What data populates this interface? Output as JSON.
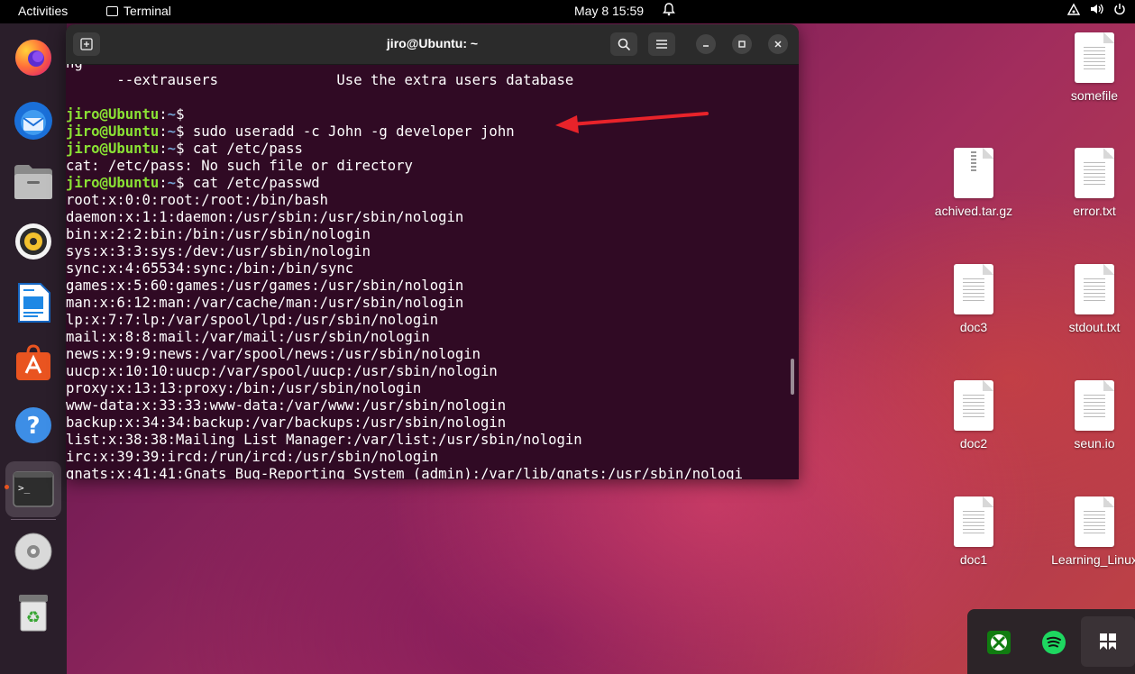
{
  "topbar": {
    "activities": "Activities",
    "app_name": "Terminal",
    "datetime": "May 8  15:59"
  },
  "dock": {
    "items": [
      "firefox",
      "thunderbird",
      "files",
      "rhythmbox",
      "libreoffice-writer",
      "app-center",
      "help",
      "terminal",
      "dvd",
      "trash"
    ]
  },
  "terminal": {
    "title": "jiro@Ubuntu: ~",
    "lines": [
      {
        "type": "text",
        "text": "ng"
      },
      {
        "type": "text",
        "text": "      --extrausers              Use the extra users database"
      },
      {
        "type": "text",
        "text": ""
      },
      {
        "type": "prompt",
        "user": "jiro@Ubuntu",
        "path": "~",
        "cmd": ""
      },
      {
        "type": "prompt",
        "user": "jiro@Ubuntu",
        "path": "~",
        "cmd": " sudo useradd -c John -g developer john"
      },
      {
        "type": "prompt",
        "user": "jiro@Ubuntu",
        "path": "~",
        "cmd": " cat /etc/pass"
      },
      {
        "type": "text",
        "text": "cat: /etc/pass: No such file or directory"
      },
      {
        "type": "prompt",
        "user": "jiro@Ubuntu",
        "path": "~",
        "cmd": " cat /etc/passwd"
      },
      {
        "type": "text",
        "text": "root:x:0:0:root:/root:/bin/bash"
      },
      {
        "type": "text",
        "text": "daemon:x:1:1:daemon:/usr/sbin:/usr/sbin/nologin"
      },
      {
        "type": "text",
        "text": "bin:x:2:2:bin:/bin:/usr/sbin/nologin"
      },
      {
        "type": "text",
        "text": "sys:x:3:3:sys:/dev:/usr/sbin/nologin"
      },
      {
        "type": "text",
        "text": "sync:x:4:65534:sync:/bin:/bin/sync"
      },
      {
        "type": "text",
        "text": "games:x:5:60:games:/usr/games:/usr/sbin/nologin"
      },
      {
        "type": "text",
        "text": "man:x:6:12:man:/var/cache/man:/usr/sbin/nologin"
      },
      {
        "type": "text",
        "text": "lp:x:7:7:lp:/var/spool/lpd:/usr/sbin/nologin"
      },
      {
        "type": "text",
        "text": "mail:x:8:8:mail:/var/mail:/usr/sbin/nologin"
      },
      {
        "type": "text",
        "text": "news:x:9:9:news:/var/spool/news:/usr/sbin/nologin"
      },
      {
        "type": "text",
        "text": "uucp:x:10:10:uucp:/var/spool/uucp:/usr/sbin/nologin"
      },
      {
        "type": "text",
        "text": "proxy:x:13:13:proxy:/bin:/usr/sbin/nologin"
      },
      {
        "type": "text",
        "text": "www-data:x:33:33:www-data:/var/www:/usr/sbin/nologin"
      },
      {
        "type": "text",
        "text": "backup:x:34:34:backup:/var/backups:/usr/sbin/nologin"
      },
      {
        "type": "text",
        "text": "list:x:38:38:Mailing List Manager:/var/list:/usr/sbin/nologin"
      },
      {
        "type": "text",
        "text": "irc:x:39:39:ircd:/run/ircd:/usr/sbin/nologin"
      },
      {
        "type": "text",
        "text": "gnats:x:41:41:Gnats Bug-Reporting System (admin):/var/lib/gnats:/usr/sbin/nologi"
      }
    ]
  },
  "desktop": {
    "icons": [
      {
        "label": "somefile",
        "kind": "text"
      },
      {
        "label": "achived.tar.gz",
        "kind": "archive"
      },
      {
        "label": "error.txt",
        "kind": "text"
      },
      {
        "label": "doc3",
        "kind": "text"
      },
      {
        "label": "stdout.txt",
        "kind": "text"
      },
      {
        "label": "doc2",
        "kind": "text"
      },
      {
        "label": "seun.io",
        "kind": "text"
      },
      {
        "label": "doc1",
        "kind": "text"
      },
      {
        "label": "Learning_Linux",
        "kind": "text"
      }
    ]
  },
  "tray": {
    "items": [
      "xbox-icon",
      "spotify-icon",
      "app-icon"
    ]
  },
  "colors": {
    "terminal_bg": "#300a24",
    "prompt_user": "#8ae234",
    "prompt_path": "#729fcf",
    "annotation_arrow": "#e8232a"
  }
}
